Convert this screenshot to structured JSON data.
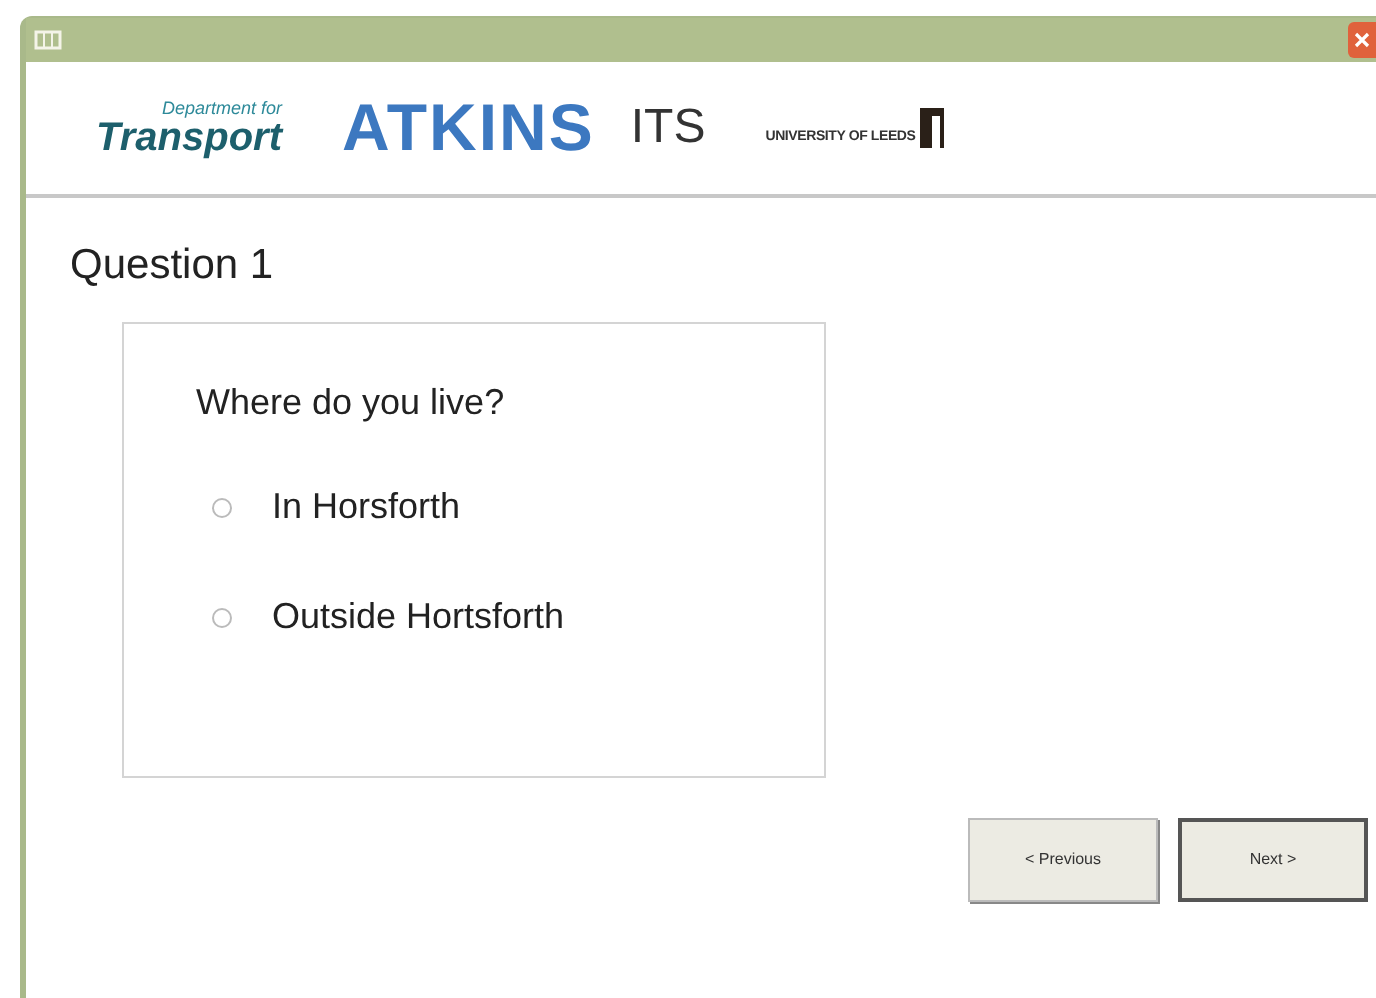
{
  "logos": {
    "dft_top": "Department for",
    "dft_bottom": "Transport",
    "atkins": "ATKINS",
    "its": "ITS",
    "leeds": "UNIVERSITY OF LEEDS"
  },
  "heading": "Question 1",
  "question": {
    "text": "Where do you live?",
    "options": [
      {
        "label": "In Horsforth",
        "selected": false
      },
      {
        "label": "Outside Hortsforth",
        "selected": false
      }
    ]
  },
  "buttons": [
    {
      "label": "< Previous",
      "default": false
    },
    {
      "label": "Next >",
      "default": true
    }
  ]
}
